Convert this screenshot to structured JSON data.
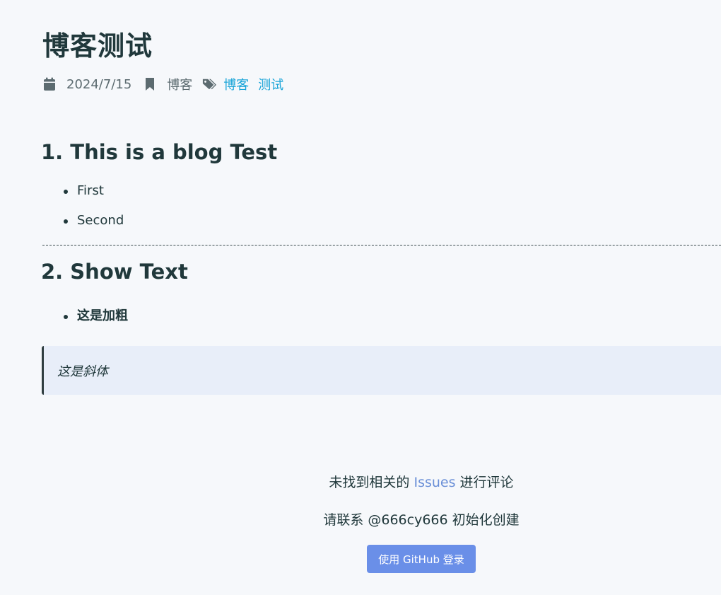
{
  "post": {
    "title": "博客测试",
    "date": "2024/7/15",
    "category": "博客",
    "tags": [
      "博客",
      "测试"
    ]
  },
  "content": {
    "section1": {
      "heading": "1. This is a blog Test",
      "items": [
        "First",
        "Second"
      ]
    },
    "section2": {
      "heading": "2. Show Text",
      "items": [
        "这是加粗"
      ]
    },
    "blockquote": "这是斜体"
  },
  "comments": {
    "line1_before": "未找到相关的 ",
    "issues_link": "Issues",
    "line1_after": " 进行评论",
    "line2": "请联系 @666cy666 初始化创建",
    "login_button": "使用 GitHub 登录"
  },
  "colors": {
    "title": "#20383b",
    "meta": "#5c6b70",
    "tag_link": "#1ba5d8",
    "issues_link": "#6a8fd7",
    "button": "#6a8fe8",
    "quote_bg": "#e8eef9"
  },
  "icons": {
    "date": "calendar-icon",
    "category": "bookmark-icon",
    "tags": "tags-icon"
  }
}
